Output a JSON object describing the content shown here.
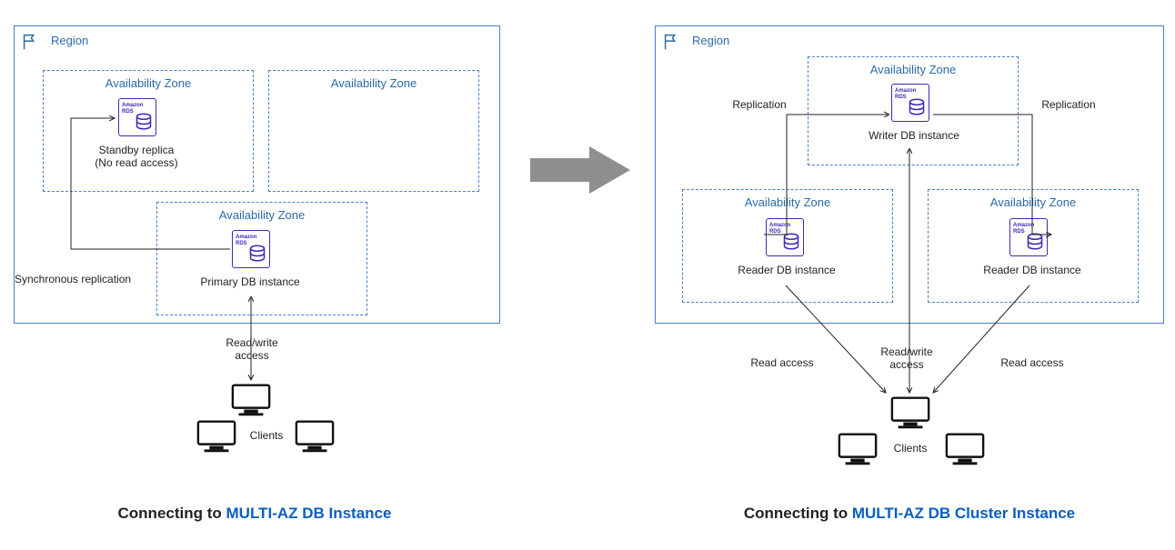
{
  "left": {
    "region_label": "Region",
    "az1_label": "Availability Zone",
    "az2_label": "Availability Zone",
    "az3_label": "Availability Zone",
    "standby_l1": "Standby replica",
    "standby_l2": "(No read access)",
    "primary_label": "Primary DB instance",
    "sync_repl": "Synchronous replication",
    "rw_access_l1": "Read/write",
    "rw_access_l2": "access",
    "clients_label": "Clients",
    "caption_prefix": "Connecting to ",
    "caption_hl": "MULTI-AZ DB Instance"
  },
  "right": {
    "region_label": "Region",
    "az_top_label": "Availability Zone",
    "az_bl_label": "Availability Zone",
    "az_br_label": "Availability Zone",
    "writer_label": "Writer DB instance",
    "reader_label": "Reader DB instance",
    "replication": "Replication",
    "read_access": "Read access",
    "rw_access_l1": "Read/write",
    "rw_access_l2": "access",
    "clients_label": "Clients",
    "caption_prefix": "Connecting to ",
    "caption_hl": "MULTI-AZ DB Cluster Instance"
  },
  "icons": {
    "rds_t1": "Amazon",
    "rds_t2": "RDS"
  }
}
